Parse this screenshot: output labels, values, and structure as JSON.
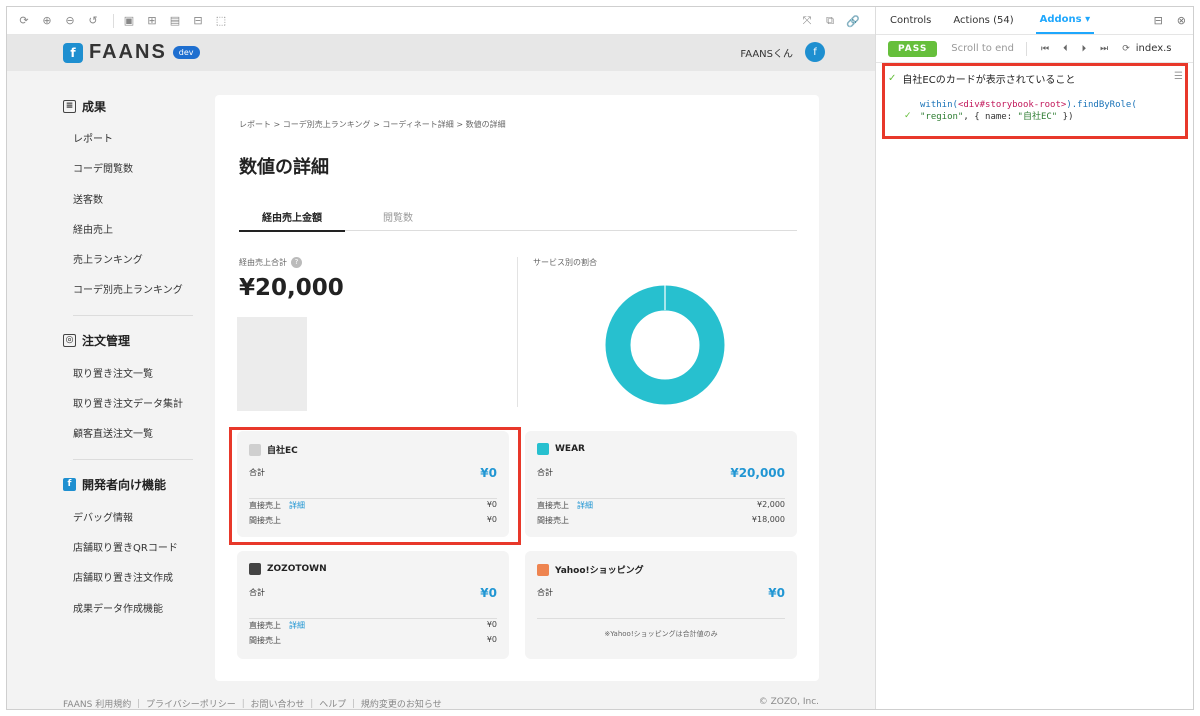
{
  "toolbar": {
    "icons": [
      "reload-icon",
      "zoom-in-icon",
      "zoom-out-icon",
      "zoom-reset-icon",
      "background-icon",
      "grid-icon",
      "viewport-icon",
      "measure-icon",
      "outline-icon"
    ],
    "right_icons": [
      "fullscreen-icon",
      "new-tab-icon",
      "copy-link-icon"
    ]
  },
  "app": {
    "brand": "FAANS",
    "badge": "dev",
    "user": "FAANSくん"
  },
  "sidebar": {
    "groups": [
      {
        "title": "成果",
        "items": [
          "レポート",
          "コーデ閲覧数",
          "送客数",
          "経由売上",
          "売上ランキング",
          "コーデ別売上ランキング"
        ]
      },
      {
        "title": "注文管理",
        "items": [
          "取り置き注文一覧",
          "取り置き注文データ集計",
          "顧客直送注文一覧"
        ]
      },
      {
        "title": "開発者向け機能",
        "items": [
          "デバッグ情報",
          "店舗取り置きQRコード",
          "店舗取り置き注文作成",
          "成果データ作成機能"
        ]
      }
    ]
  },
  "main": {
    "breadcrumb": "レポート  >  コーデ別売上ランキング  >  コーディネート詳細  >  数値の詳細",
    "title": "数値の詳細",
    "tabs": [
      "経由売上金額",
      "閲覧数"
    ],
    "total_label": "経由売上合計",
    "total_amount": "¥20,000",
    "share_label": "サービス別の割合",
    "donut": {
      "color": "#27c0cf",
      "share_wear": 1.0
    }
  },
  "services": [
    {
      "name": "自社EC",
      "color": "#cfcfcf",
      "sum_label": "合計",
      "sum": "¥0",
      "direct_label": "直接売上",
      "detail": "詳細",
      "direct": "¥0",
      "indirect_label": "間接売上",
      "indirect": "¥0"
    },
    {
      "name": "WEAR",
      "color": "#27c0cf",
      "sum_label": "合計",
      "sum": "¥20,000",
      "direct_label": "直接売上",
      "detail": "詳細",
      "direct": "¥2,000",
      "indirect_label": "間接売上",
      "indirect": "¥18,000"
    },
    {
      "name": "ZOZOTOWN",
      "color": "#444444",
      "sum_label": "合計",
      "sum": "¥0",
      "direct_label": "直接売上",
      "detail": "詳細",
      "direct": "¥0",
      "indirect_label": "間接売上",
      "indirect": "¥0"
    },
    {
      "name": "Yahoo!ショッピング",
      "color": "#ee8450",
      "sum_label": "合計",
      "sum": "¥0",
      "note": "※Yahoo!ショッピングは合計値のみ"
    }
  ],
  "footer": {
    "links": "FAANS 利用規約  ｜  プライバシーポリシー  ｜  お問い合わせ  ｜  ヘルプ  ｜  規約変更のお知らせ",
    "copyright": "© ZOZO, Inc."
  },
  "panel": {
    "tabs": [
      "Controls",
      "Actions (54)",
      "Addons"
    ],
    "status": "PASS",
    "scroll_end": "Scroll to end",
    "file": "index.s",
    "test_name": "自社ECのカードが表示されていること",
    "code_line1_a": "within(",
    "code_line1_tag": "<div#storybook-root>",
    "code_line1_b": ").findByRole(",
    "code_line2_str1": "\"region\"",
    "code_line2_mid": ", { name: ",
    "code_line2_str2": "\"自社EC\"",
    "code_line2_end": " })"
  }
}
